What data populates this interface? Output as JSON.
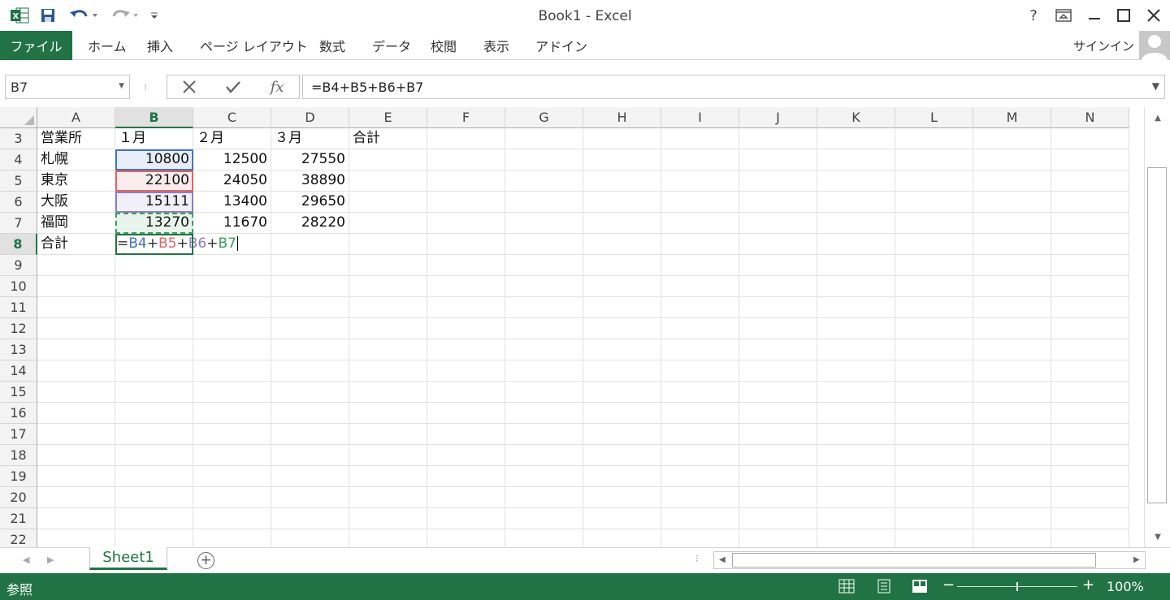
{
  "window": {
    "title": "Book1 - Excel",
    "help": "?"
  },
  "ribbon": {
    "file_tab": "ファイル",
    "tabs": [
      "ホーム",
      "挿入",
      "ページ レイアウト",
      "数式",
      "データ",
      "校閲",
      "表示",
      "アドイン"
    ],
    "signin": "サインイン"
  },
  "formula_bar": {
    "name_box": "B7",
    "fx": "fx",
    "formula": "=B4+B5+B6+B7"
  },
  "grid": {
    "columns": [
      "A",
      "B",
      "C",
      "D",
      "E",
      "F",
      "G",
      "H",
      "I",
      "J",
      "K",
      "L",
      "M",
      "N"
    ],
    "selected_column": "B",
    "rows": [
      "3",
      "4",
      "5",
      "6",
      "7",
      "8",
      "9",
      "10",
      "11",
      "12",
      "13",
      "14",
      "15",
      "16",
      "17",
      "18",
      "19",
      "20",
      "21",
      "22"
    ],
    "selected_row": "8",
    "cells": {
      "A3": "営業所",
      "B3": "１月",
      "C3": "２月",
      "D3": "３月",
      "E3": "合計",
      "A4": "札幌",
      "B4": "10800",
      "C4": "12500",
      "D4": "27550",
      "A5": "東京",
      "B5": "22100",
      "C5": "24050",
      "D5": "38890",
      "A6": "大阪",
      "B6": "15111",
      "C6": "13400",
      "D6": "29650",
      "A7": "福岡",
      "B7": "13270",
      "C7": "11670",
      "D7": "28220",
      "A8": "合計"
    },
    "editing_formula_parts": [
      {
        "text": "=",
        "color": "#333333"
      },
      {
        "text": "B4",
        "color": "#4472c4"
      },
      {
        "text": "+",
        "color": "#333333"
      },
      {
        "text": "B5",
        "color": "#e06666"
      },
      {
        "text": "+",
        "color": "#333333"
      },
      {
        "text": "B6",
        "color": "#8e7cc3"
      },
      {
        "text": "+",
        "color": "#333333"
      },
      {
        "text": "B7",
        "color": "#38a05a"
      }
    ],
    "ref_colors": {
      "B4": "#4472c4",
      "B5": "#e06666",
      "B6": "#8e7cc3",
      "B7": "#38a05a"
    }
  },
  "sheets": {
    "tabs": [
      "Sheet1"
    ],
    "active": "Sheet1"
  },
  "status": {
    "mode": "参照",
    "zoom": "100%"
  },
  "colors": {
    "accent": "#217346"
  }
}
